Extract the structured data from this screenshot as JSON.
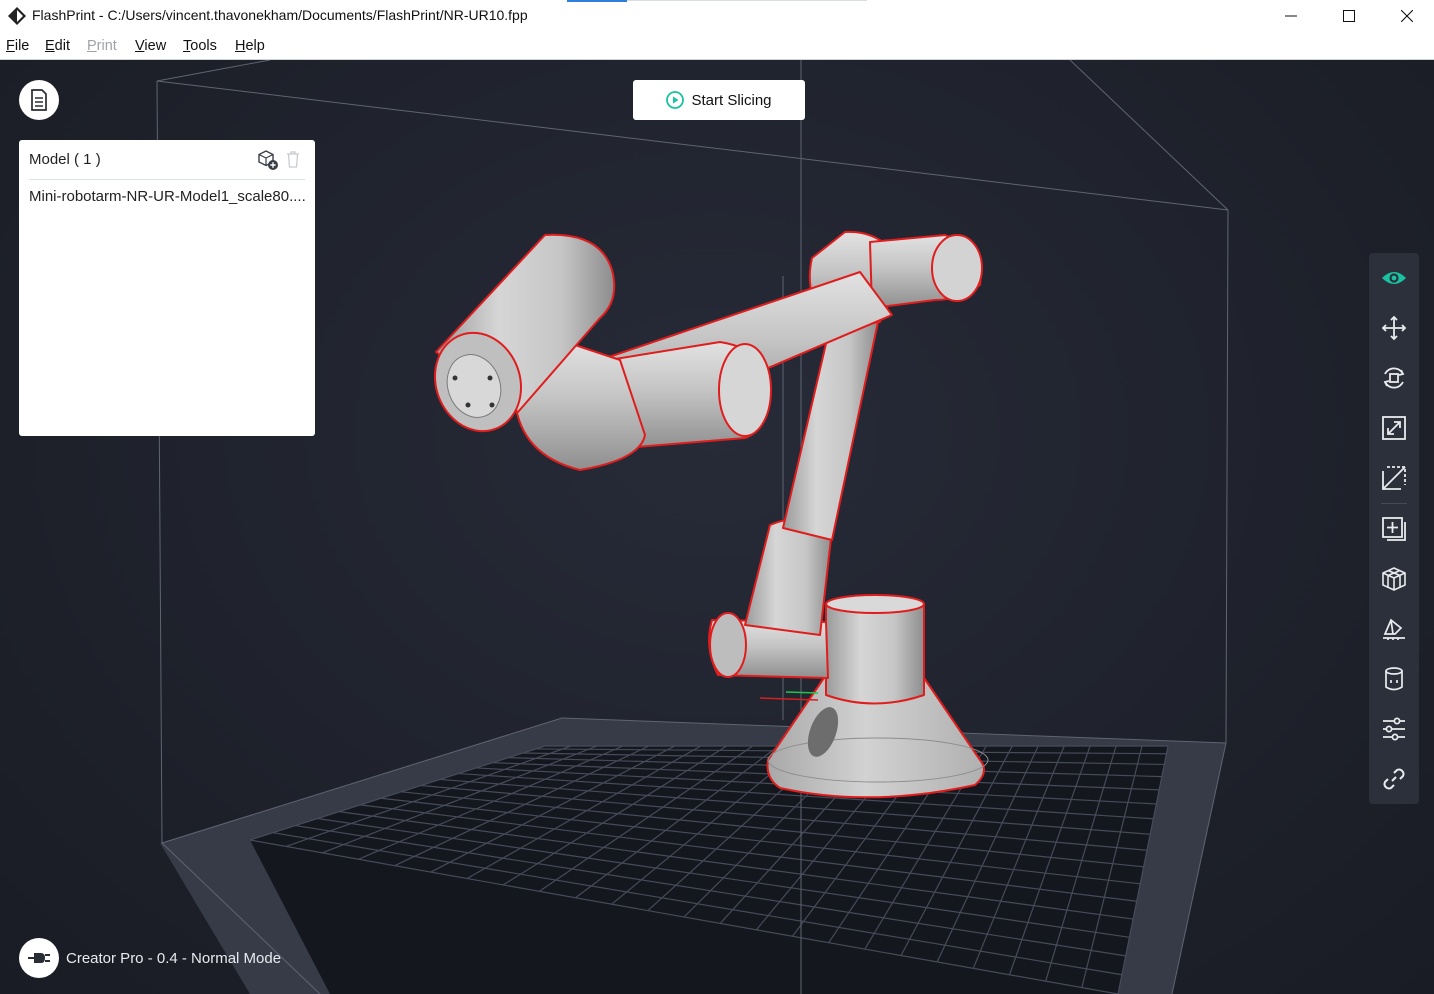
{
  "window": {
    "title": "FlashPrint - C:/Users/vincent.thavonekham/Documents/FlashPrint/NR-UR10.fpp",
    "minimize_icon": "minimize-icon",
    "maximize_icon": "maximize-icon",
    "close_icon": "close-icon"
  },
  "menu": [
    {
      "label": "File",
      "accel": "F",
      "rest": "ile",
      "enabled": true
    },
    {
      "label": "Edit",
      "accel": "E",
      "rest": "dit",
      "enabled": true
    },
    {
      "label": "Print",
      "accel": "P",
      "rest": "rint",
      "enabled": false
    },
    {
      "label": "View",
      "accel": "V",
      "rest": "iew",
      "enabled": true
    },
    {
      "label": "Tools",
      "accel": "T",
      "rest": "ools",
      "enabled": true
    },
    {
      "label": "Help",
      "accel": "H",
      "rest": "elp",
      "enabled": true
    }
  ],
  "slice_button": {
    "label": "Start Slicing",
    "icon": "play-circle-icon",
    "accent": "#19c3a1"
  },
  "model_panel": {
    "title": "Model ( 1 )",
    "items": [
      "Mini-robotarm-NR-UR-Model1_scale80...."
    ]
  },
  "right_toolbar": [
    {
      "name": "view-icon",
      "active": true
    },
    {
      "name": "move-icon"
    },
    {
      "name": "rotate-icon"
    },
    {
      "name": "scale-icon"
    },
    {
      "name": "cut-icon"
    },
    {
      "name": "add-model-icon"
    },
    {
      "name": "split-icon"
    },
    {
      "name": "place-on-surface-icon"
    },
    {
      "name": "supports-icon"
    },
    {
      "name": "settings-icon"
    },
    {
      "name": "link-icon"
    }
  ],
  "status": {
    "printer": "Creator Pro - 0.4 - Normal Mode",
    "icon": "printer-connect-icon"
  },
  "colors": {
    "accent": "#19c3a1",
    "model": "#c9c9c9",
    "outline": "#e01d1d",
    "background": "#1f222c"
  }
}
